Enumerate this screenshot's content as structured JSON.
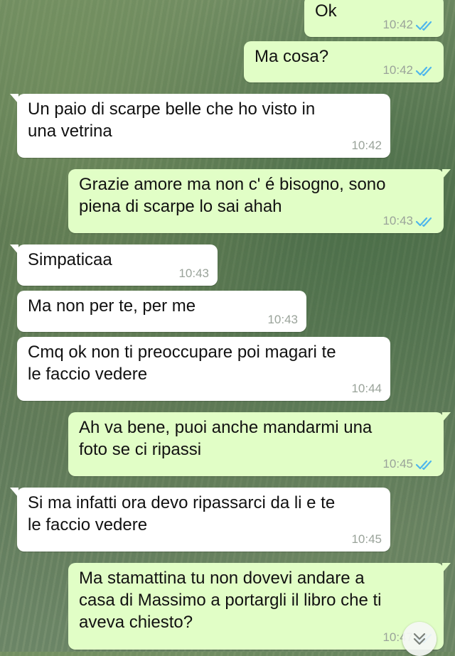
{
  "messages": [
    {
      "direction": "out",
      "text": "Ok",
      "time": "10:42",
      "read": true
    },
    {
      "direction": "out",
      "text": "Ma cosa?",
      "time": "10:42",
      "read": true
    },
    {
      "direction": "in",
      "text": "Un paio di scarpe belle che ho visto in\nuna vetrina",
      "time": "10:42"
    },
    {
      "direction": "out",
      "text": "Grazie amore ma non c' é bisogno, sono\npiena di scarpe lo sai ahah",
      "time": "10:43",
      "read": true
    },
    {
      "direction": "in",
      "text": "Simpaticaa",
      "time": "10:43"
    },
    {
      "direction": "in",
      "text": "Ma non per te, per me",
      "time": "10:43"
    },
    {
      "direction": "in",
      "text": "Cmq ok non ti preoccupare poi magari te\nle faccio vedere",
      "time": "10:44"
    },
    {
      "direction": "out",
      "text": "Ah va bene, puoi anche mandarmi una\nfoto se ci ripassi",
      "time": "10:45",
      "read": true
    },
    {
      "direction": "in",
      "text": "Si ma infatti ora devo ripassarci da li e te\nle faccio vedere",
      "time": "10:45"
    },
    {
      "direction": "out",
      "text": "Ma stamattina tu non dovevi andare a\ncasa di Massimo a portargli il libro che ti\naveva chiesto?",
      "time": "10:47",
      "read": true
    }
  ],
  "colors": {
    "incoming_bubble": "#ffffff",
    "outgoing_bubble": "#e1fec6",
    "read_ticks": "#4fb6ec",
    "timestamp": "#9aa39a"
  },
  "icons": {
    "read_receipt": "double-check-icon",
    "scroll_down": "chevron-down-double-icon"
  }
}
